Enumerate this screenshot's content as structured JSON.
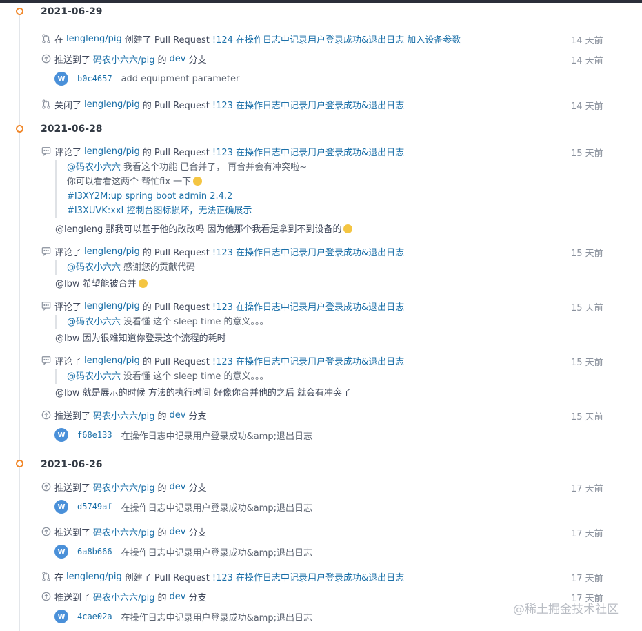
{
  "groups": [
    {
      "date": "2021-06-29",
      "events": [
        {
          "icon": "pull-request-icon",
          "prefix": "在",
          "repo": "lengleng/pig",
          "mid": "创建了 Pull Request",
          "pr": "!124 在操作日志中记录用户登录成功&退出日志 加入设备参数",
          "time": "14 天前"
        },
        {
          "icon": "push-icon",
          "prefix": "推送到了",
          "repo": "码农小六六/pig",
          "mid": "的",
          "branch": "dev",
          "suffix": "分支",
          "time": "14 天前",
          "commit": {
            "avatar": "W",
            "sha": "b0c4657",
            "message": "add equipment parameter"
          }
        },
        {
          "icon": "pull-request-icon",
          "prefix": "关闭了",
          "repo": "lengleng/pig",
          "mid": "的 Pull Request",
          "pr": "!123 在操作日志中记录用户登录成功&退出日志",
          "time": "14 天前"
        }
      ]
    },
    {
      "date": "2021-06-28",
      "events": [
        {
          "icon": "comment-icon",
          "prefix": "评论了",
          "repo": "lengleng/pig",
          "mid": "的 Pull Request",
          "pr": "!123 在操作日志中记录用户登录成功&退出日志",
          "time": "15 天前",
          "quote": [
            "@码农小六六",
            "我看这个功能 已合并了， 再合并会有冲突啦~",
            "你可以看看这两个 帮忙fix 一下",
            "#I3XY2M:up spring boot admin 2.4.2",
            "#I3XUVK:xxl 控制台图标损坏，无法正确展示"
          ],
          "reply": "@lengleng 那我可以基于他的改改吗 因为他那个我看是拿到不到设备的"
        },
        {
          "icon": "comment-icon",
          "prefix": "评论了",
          "repo": "lengleng/pig",
          "mid": "的 Pull Request",
          "pr": "!123 在操作日志中记录用户登录成功&退出日志",
          "time": "15 天前",
          "quote": [
            "@码农小六六",
            "感谢您的贡献代码"
          ],
          "reply": "@lbw 希望能被合并"
        },
        {
          "icon": "comment-icon",
          "prefix": "评论了",
          "repo": "lengleng/pig",
          "mid": "的 Pull Request",
          "pr": "!123 在操作日志中记录用户登录成功&退出日志",
          "time": "15 天前",
          "quote": [
            "@码农小六六",
            "没看懂 这个 sleep time 的意义。。。"
          ],
          "reply": "@lbw 因为很难知道你登录这个流程的耗时"
        },
        {
          "icon": "comment-icon",
          "prefix": "评论了",
          "repo": "lengleng/pig",
          "mid": "的 Pull Request",
          "pr": "!123 在操作日志中记录用户登录成功&退出日志",
          "time": "15 天前",
          "quote": [
            "@码农小六六",
            "没看懂 这个 sleep time 的意义。。。"
          ],
          "reply": "@lbw 就是展示的时候 方法的执行时间 好像你合并他的之后 就会有冲突了"
        },
        {
          "icon": "push-icon",
          "prefix": "推送到了",
          "repo": "码农小六六/pig",
          "mid": "的",
          "branch": "dev",
          "suffix": "分支",
          "time": "15 天前",
          "commit": {
            "avatar": "W",
            "sha": "f68e133",
            "message": "在操作日志中记录用户登录成功&amp;退出日志"
          }
        }
      ]
    },
    {
      "date": "2021-06-26",
      "events": [
        {
          "icon": "push-icon",
          "prefix": "推送到了",
          "repo": "码农小六六/pig",
          "mid": "的",
          "branch": "dev",
          "suffix": "分支",
          "time": "17 天前",
          "commit": {
            "avatar": "W",
            "sha": "d5749af",
            "message": "在操作日志中记录用户登录成功&amp;退出日志"
          }
        },
        {
          "icon": "push-icon",
          "prefix": "推送到了",
          "repo": "码农小六六/pig",
          "mid": "的",
          "branch": "dev",
          "suffix": "分支",
          "time": "17 天前",
          "commit": {
            "avatar": "W",
            "sha": "6a8b666",
            "message": "在操作日志中记录用户登录成功&amp;退出日志"
          }
        },
        {
          "icon": "pull-request-icon",
          "prefix": "在",
          "repo": "lengleng/pig",
          "mid": "创建了 Pull Request",
          "pr": "!123 在操作日志中记录用户登录成功&退出日志",
          "time": "17 天前"
        },
        {
          "icon": "push-icon",
          "prefix": "推送到了",
          "repo": "码农小六六/pig",
          "mid": "的",
          "branch": "dev",
          "suffix": "分支",
          "time": "17 天前",
          "commit": {
            "avatar": "W",
            "sha": "4cae02a",
            "message": "在操作日志中记录用户登录成功&amp;退出日志"
          }
        }
      ]
    }
  ],
  "watermark": "@稀土掘金技术社区",
  "colors": {
    "accent_dot": "#f1882b",
    "link": "#1a6fa8",
    "avatar_bg": "#4a90d9"
  }
}
